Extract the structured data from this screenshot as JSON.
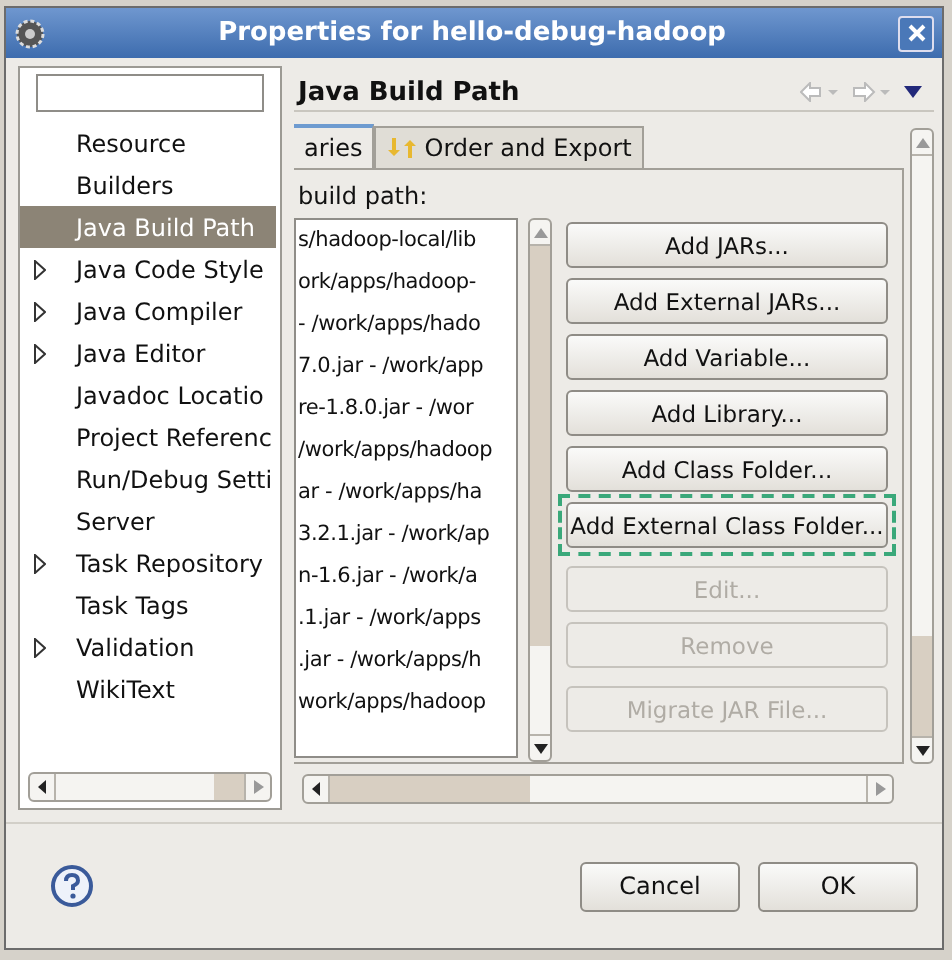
{
  "window": {
    "title": "Properties for hello-debug-hadoop"
  },
  "sidebar": {
    "items": [
      {
        "label": "Resource",
        "expandable": false,
        "selected": false
      },
      {
        "label": "Builders",
        "expandable": false,
        "selected": false
      },
      {
        "label": "Java Build Path",
        "expandable": false,
        "selected": true
      },
      {
        "label": "Java Code Style",
        "expandable": true,
        "selected": false
      },
      {
        "label": "Java Compiler",
        "expandable": true,
        "selected": false
      },
      {
        "label": "Java Editor",
        "expandable": true,
        "selected": false
      },
      {
        "label": "Javadoc Locatio",
        "expandable": false,
        "selected": false
      },
      {
        "label": "Project Referenc",
        "expandable": false,
        "selected": false
      },
      {
        "label": "Run/Debug Setti",
        "expandable": false,
        "selected": false
      },
      {
        "label": "Server",
        "expandable": false,
        "selected": false
      },
      {
        "label": "Task Repository",
        "expandable": true,
        "selected": false
      },
      {
        "label": "Task Tags",
        "expandable": false,
        "selected": false
      },
      {
        "label": "Validation",
        "expandable": true,
        "selected": false
      },
      {
        "label": "WikiText",
        "expandable": false,
        "selected": false
      }
    ]
  },
  "page": {
    "title": "Java Build Path",
    "tabs": [
      {
        "label": "aries",
        "selected": true
      },
      {
        "label": "Order and Export",
        "selected": false
      }
    ],
    "list_label": "build path:",
    "entries": [
      "s/hadoop-local/lib",
      "ork/apps/hadoop-",
      "- /work/apps/hado",
      "7.0.jar - /work/app",
      "re-1.8.0.jar - /wor",
      "/work/apps/hadoop",
      "ar - /work/apps/ha",
      "3.2.1.jar - /work/ap",
      "n-1.6.jar - /work/a",
      ".1.jar - /work/apps",
      ".jar - /work/apps/h",
      "work/apps/hadoop"
    ],
    "buttons": [
      {
        "label": "Add JARs...",
        "disabled": false,
        "focused": false
      },
      {
        "label": "Add External JARs...",
        "disabled": false,
        "focused": false
      },
      {
        "label": "Add Variable...",
        "disabled": false,
        "focused": false
      },
      {
        "label": "Add Library...",
        "disabled": false,
        "focused": false
      },
      {
        "label": "Add Class Folder...",
        "disabled": false,
        "focused": false
      },
      {
        "label": "Add External Class Folder...",
        "disabled": false,
        "focused": true
      },
      {
        "label": "Edit...",
        "disabled": true,
        "focused": false
      },
      {
        "label": "Remove",
        "disabled": true,
        "focused": false
      },
      {
        "label": "Migrate JAR File...",
        "disabled": true,
        "focused": false
      }
    ]
  },
  "footer": {
    "buttons": [
      "Cancel",
      "OK"
    ]
  }
}
